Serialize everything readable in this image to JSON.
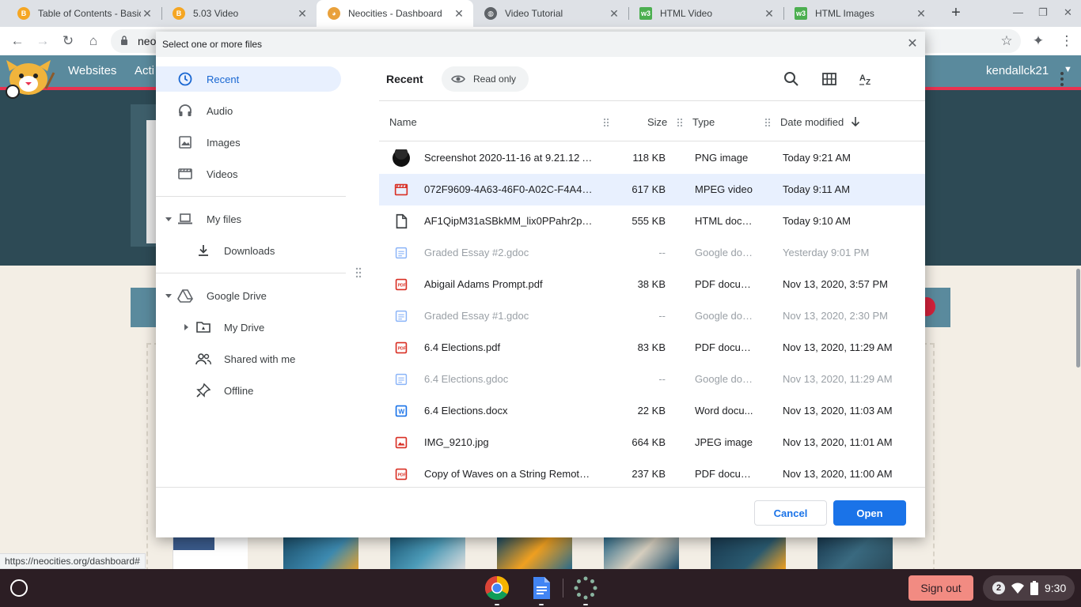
{
  "browser": {
    "tabs": [
      {
        "title": "Table of Contents - Basic",
        "icon": "badge-icon",
        "color": "#f5a623"
      },
      {
        "title": "5.03 Video",
        "icon": "badge-icon",
        "color": "#f5a623"
      },
      {
        "title": "Neocities - Dashboard",
        "icon": "neocities-icon",
        "color": "#e9a13b"
      },
      {
        "title": "Video Tutorial",
        "icon": "globe-icon",
        "color": "#5f6368"
      },
      {
        "title": "HTML Video",
        "icon": "w3-icon",
        "color": "#4caf50"
      },
      {
        "title": "HTML Images",
        "icon": "w3-icon",
        "color": "#4caf50"
      }
    ],
    "omnibox_text": "neo"
  },
  "page": {
    "nav_items": [
      "Websites",
      "Acti"
    ],
    "user": "kendallck21",
    "status_url": "https://neocities.org/dashboard#"
  },
  "dialog": {
    "title": "Select one or more files",
    "nav": {
      "recent": "Recent",
      "audio": "Audio",
      "images": "Images",
      "videos": "Videos",
      "my_files": "My files",
      "downloads": "Downloads",
      "google_drive": "Google Drive",
      "my_drive": "My Drive",
      "shared": "Shared with me",
      "offline": "Offline"
    },
    "breadcrumb": "Recent",
    "read_only_chip": "Read only",
    "columns": {
      "name": "Name",
      "size": "Size",
      "type": "Type",
      "date": "Date modified"
    },
    "files": [
      {
        "name": "Screenshot 2020-11-16 at 9.21.12 A...",
        "size": "118 KB",
        "type": "PNG image",
        "date": "Today 9:21 AM",
        "icon": "image-thumbnail-icon",
        "selected": false,
        "dim": false
      },
      {
        "name": "072F9609-4A63-46F0-A02C-F4A4A5...",
        "size": "617 KB",
        "type": "MPEG video",
        "date": "Today 9:11 AM",
        "icon": "video-file-icon",
        "selected": true,
        "dim": false
      },
      {
        "name": "AF1QipM31aSBkMM_lix0PPahr2pw...",
        "size": "555 KB",
        "type": "HTML docu...",
        "date": "Today 9:10 AM",
        "icon": "generic-file-icon",
        "selected": false,
        "dim": false
      },
      {
        "name": "Graded Essay #2.gdoc",
        "size": "--",
        "type": "Google doc...",
        "date": "Yesterday 9:01 PM",
        "icon": "gdoc-icon",
        "selected": false,
        "dim": true
      },
      {
        "name": "Abigail Adams Prompt.pdf",
        "size": "38 KB",
        "type": "PDF docum...",
        "date": "Nov 13, 2020, 3:57 PM",
        "icon": "pdf-icon",
        "selected": false,
        "dim": false
      },
      {
        "name": "Graded Essay #1.gdoc",
        "size": "--",
        "type": "Google doc...",
        "date": "Nov 13, 2020, 2:30 PM",
        "icon": "gdoc-icon",
        "selected": false,
        "dim": true
      },
      {
        "name": "6.4 Elections.pdf",
        "size": "83 KB",
        "type": "PDF docum...",
        "date": "Nov 13, 2020, 11:29 AM",
        "icon": "pdf-icon",
        "selected": false,
        "dim": false
      },
      {
        "name": "6.4 Elections.gdoc",
        "size": "--",
        "type": "Google doc...",
        "date": "Nov 13, 2020, 11:29 AM",
        "icon": "gdoc-icon",
        "selected": false,
        "dim": true
      },
      {
        "name": "6.4 Elections.docx",
        "size": "22 KB",
        "type": "Word docu...",
        "date": "Nov 13, 2020, 11:03 AM",
        "icon": "word-icon",
        "selected": false,
        "dim": false
      },
      {
        "name": "IMG_9210.jpg",
        "size": "664 KB",
        "type": "JPEG image",
        "date": "Nov 13, 2020, 11:01 AM",
        "icon": "image-file-icon",
        "selected": false,
        "dim": false
      },
      {
        "name": "Copy of Waves on a String Remote L...",
        "size": "237 KB",
        "type": "PDF docum...",
        "date": "Nov 13, 2020, 11:00 AM",
        "icon": "pdf-icon",
        "selected": false,
        "dim": false
      }
    ],
    "cancel_label": "Cancel",
    "open_label": "Open"
  },
  "shelf": {
    "sign_out": "Sign out",
    "notification_count": "2",
    "time": "9:30"
  },
  "colors": {
    "accent": "#1a73e8",
    "selection": "#e8f0fe",
    "pdf_red": "#d93025",
    "word_blue": "#1a73e8"
  }
}
